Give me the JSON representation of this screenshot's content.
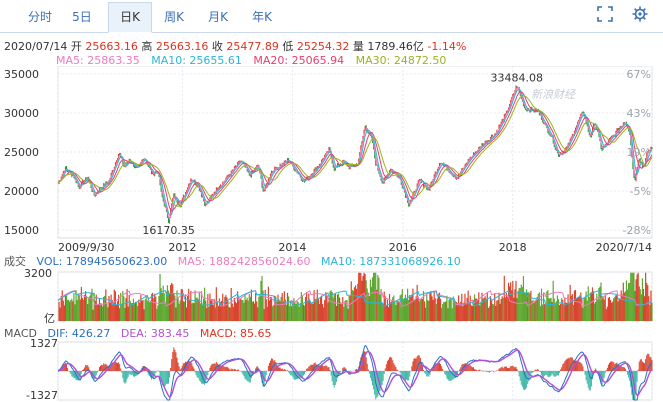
{
  "tabs": [
    {
      "label": "分时"
    },
    {
      "label": "5日"
    },
    {
      "label": "日K",
      "active": true
    },
    {
      "label": "周K"
    },
    {
      "label": "月K"
    },
    {
      "label": "年K"
    }
  ],
  "icons": [
    "fullscreen-icon",
    "settings-icon"
  ],
  "info": {
    "date": "2020/07/14",
    "open_label": "开",
    "open": "25663.16",
    "high_label": "高",
    "high": "25663.16",
    "close_label": "收",
    "close": "25477.89",
    "low_label": "低",
    "low": "25254.32",
    "volume_label": "量",
    "volume": "1789.46亿",
    "change": "-1.14%"
  },
  "ma": {
    "ma5": "MA5: 25863.35",
    "ma10": "MA10: 25655.61",
    "ma20": "MA20: 25065.94",
    "ma30": "MA30: 24872.50",
    "colors": {
      "ma5": "#f07ac0",
      "ma10": "#2bb5d9",
      "ma20": "#e83e6d",
      "ma30": "#9ab51c"
    }
  },
  "watermark": "新浪财经",
  "volume_panel": {
    "label": "成交",
    "vol": "VOL: 178945650623.00",
    "ma5": "MA5: 188242856024.60",
    "ma10": "MA10: 187331068926.10",
    "top_tick": "3200",
    "bottom_tick": "亿"
  },
  "macd_panel": {
    "label": "MACD",
    "dif": "DIF: 426.27",
    "dea": "DEA: 383.45",
    "macd": "MACD: 85.65",
    "top_tick": "1327",
    "bottom_tick": "-1327"
  },
  "chart_data": {
    "type": "line",
    "y_ticks": [
      35000,
      30000,
      25000,
      20000,
      15000
    ],
    "y_ticks_text": [
      "35000",
      "30000",
      "25000",
      "20000",
      "15000"
    ],
    "ylim": [
      14000,
      36000
    ],
    "pct_ticks": [
      "67%",
      "43%",
      "19%",
      "-5%",
      "-28%"
    ],
    "x_tick_labels": [
      "2009/9/30",
      "2012",
      "2014",
      "2016",
      "2018",
      "2020/7/14"
    ],
    "x_range": [
      "2009-09-30",
      "2020-07-14"
    ],
    "annotations": [
      {
        "text": "33484.08",
        "x": "2018-01-29",
        "y": 33484.08
      },
      {
        "text": "16170.35",
        "x": "2011-10-04",
        "y": 16170.35
      }
    ],
    "price_anchors": [
      [
        "2009-09-30",
        21000
      ],
      [
        "2009-11-15",
        22900
      ],
      [
        "2010-01-10",
        22000
      ],
      [
        "2010-02-15",
        20500
      ],
      [
        "2010-04-15",
        21800
      ],
      [
        "2010-05-25",
        19400
      ],
      [
        "2010-07-15",
        20500
      ],
      [
        "2010-09-01",
        21200
      ],
      [
        "2010-11-08",
        24900
      ],
      [
        "2010-12-15",
        23000
      ],
      [
        "2011-01-15",
        24000
      ],
      [
        "2011-03-15",
        22700
      ],
      [
        "2011-04-25",
        24400
      ],
      [
        "2011-06-15",
        22200
      ],
      [
        "2011-07-25",
        22600
      ],
      [
        "2011-08-15",
        19800
      ],
      [
        "2011-10-04",
        16170
      ],
      [
        "2011-11-05",
        19500
      ],
      [
        "2011-12-20",
        18200
      ],
      [
        "2012-02-29",
        21600
      ],
      [
        "2012-04-15",
        20800
      ],
      [
        "2012-06-04",
        18200
      ],
      [
        "2012-08-15",
        20200
      ],
      [
        "2012-10-15",
        21500
      ],
      [
        "2013-01-25",
        23900
      ],
      [
        "2013-03-25",
        22000
      ],
      [
        "2013-05-20",
        23300
      ],
      [
        "2013-06-24",
        19800
      ],
      [
        "2013-08-15",
        22500
      ],
      [
        "2013-12-05",
        24000
      ],
      [
        "2014-03-20",
        21200
      ],
      [
        "2014-06-15",
        23000
      ],
      [
        "2014-09-03",
        25300
      ],
      [
        "2014-10-05",
        22900
      ],
      [
        "2014-12-10",
        23800
      ],
      [
        "2015-01-15",
        23000
      ],
      [
        "2015-03-12",
        23500
      ],
      [
        "2015-04-28",
        28400
      ],
      [
        "2015-06-15",
        26500
      ],
      [
        "2015-07-08",
        23500
      ],
      [
        "2015-08-24",
        21000
      ],
      [
        "2015-10-15",
        22900
      ],
      [
        "2015-12-15",
        21600
      ],
      [
        "2016-02-12",
        18300
      ],
      [
        "2016-04-25",
        21400
      ],
      [
        "2016-06-24",
        20200
      ],
      [
        "2016-09-08",
        23800
      ],
      [
        "2016-12-28",
        21600
      ],
      [
        "2017-03-15",
        24000
      ],
      [
        "2017-06-15",
        25900
      ],
      [
        "2017-09-15",
        27500
      ],
      [
        "2017-11-22",
        30000
      ],
      [
        "2018-01-29",
        33484
      ],
      [
        "2018-03-26",
        30500
      ],
      [
        "2018-06-15",
        30300
      ],
      [
        "2018-09-15",
        27000
      ],
      [
        "2018-10-30",
        24600
      ],
      [
        "2018-12-27",
        25500
      ],
      [
        "2019-03-15",
        29000
      ],
      [
        "2019-04-15",
        30200
      ],
      [
        "2019-05-30",
        26900
      ],
      [
        "2019-07-03",
        28900
      ],
      [
        "2019-08-15",
        25300
      ],
      [
        "2019-11-15",
        27400
      ],
      [
        "2020-01-17",
        29000
      ],
      [
        "2020-02-15",
        27700
      ],
      [
        "2020-03-19",
        21100
      ],
      [
        "2020-04-15",
        24200
      ],
      [
        "2020-05-25",
        22900
      ],
      [
        "2020-06-10",
        25000
      ],
      [
        "2020-07-14",
        25478
      ]
    ],
    "series": [
      {
        "name": "MA5",
        "color": "#f07ac0"
      },
      {
        "name": "MA10",
        "color": "#2bb5d9"
      },
      {
        "name": "MA20",
        "color": "#e83e6d"
      },
      {
        "name": "MA30",
        "color": "#9ab51c"
      }
    ],
    "volume_range": [
      0,
      3200
    ],
    "macd_range": [
      -1327,
      1327
    ],
    "grid": true
  }
}
